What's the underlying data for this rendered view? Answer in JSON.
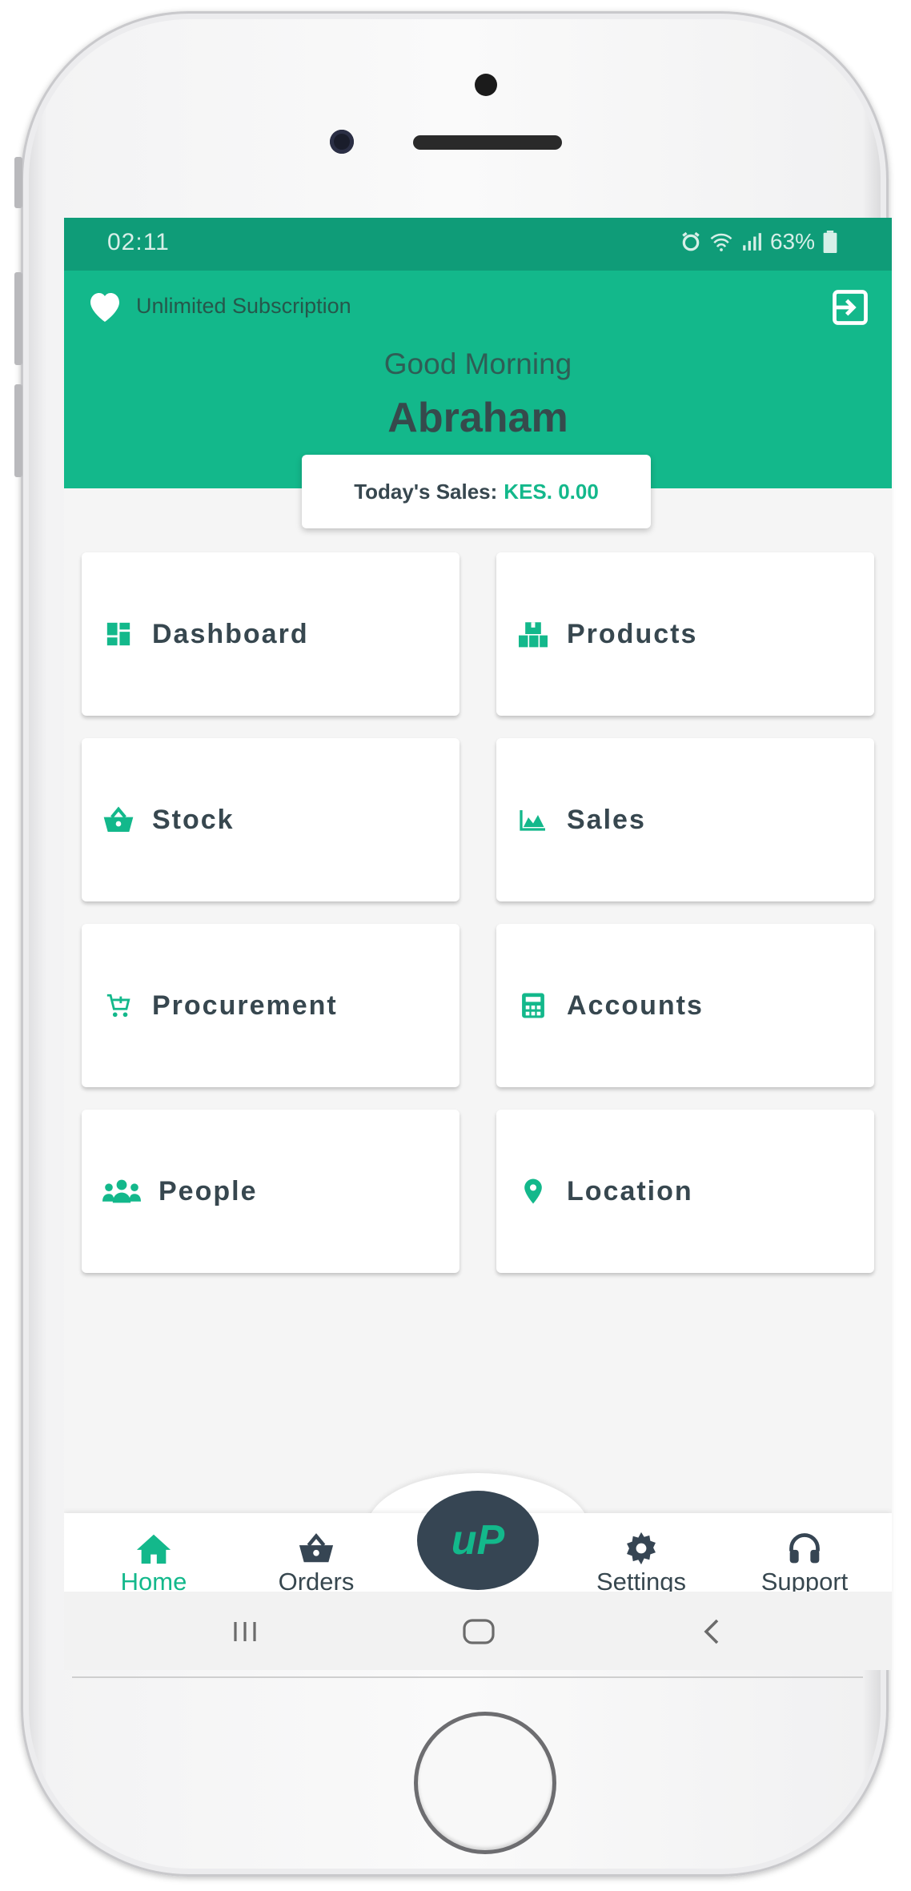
{
  "status_bar": {
    "time": "02:11",
    "battery": "63%"
  },
  "header": {
    "subscription": "Unlimited Subscription",
    "greeting": "Good Morning",
    "user_name": "Abraham"
  },
  "sales": {
    "label": "Today's Sales:",
    "value": "KES. 0.00"
  },
  "tiles": [
    {
      "label": "Dashboard",
      "icon": "dashboard-icon"
    },
    {
      "label": "Products",
      "icon": "boxes-icon"
    },
    {
      "label": "Stock",
      "icon": "basket-icon"
    },
    {
      "label": "Sales",
      "icon": "area-chart-icon"
    },
    {
      "label": "Procurement",
      "icon": "cart-plus-icon"
    },
    {
      "label": "Accounts",
      "icon": "calculator-icon"
    },
    {
      "label": "People",
      "icon": "users-icon"
    },
    {
      "label": "Location",
      "icon": "map-pin-icon"
    }
  ],
  "bottom_nav": {
    "items": [
      {
        "label": "Home",
        "icon": "home-icon",
        "active": true
      },
      {
        "label": "Orders",
        "icon": "basket-icon"
      },
      {
        "label": "Settings",
        "icon": "gear-icon"
      },
      {
        "label": "Support",
        "icon": "headset-icon"
      }
    ],
    "center_logo": "uP"
  },
  "colors": {
    "primary": "#13b88b",
    "status_bar": "#0f9c78",
    "dark": "#364553",
    "text": "#37474f"
  }
}
